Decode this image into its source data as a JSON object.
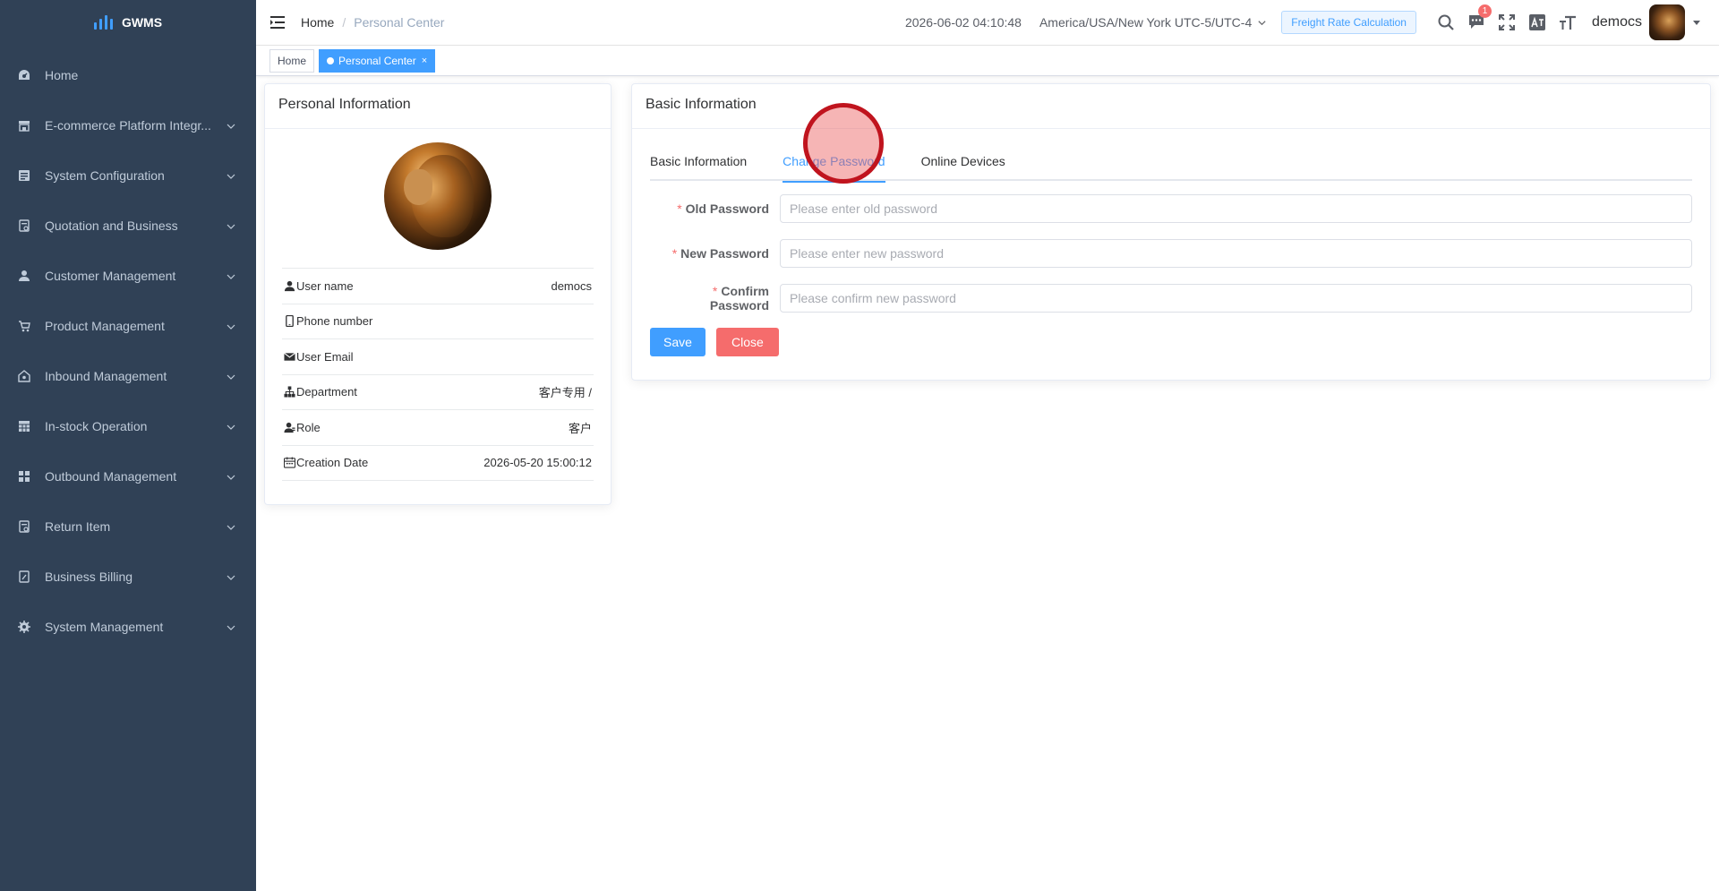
{
  "app": {
    "name": "GWMS"
  },
  "sidebar": {
    "items": [
      {
        "label": "Home",
        "icon": "dashboard-icon",
        "expandable": false
      },
      {
        "label": "E-commerce Platform Integr...",
        "icon": "store-icon",
        "expandable": true
      },
      {
        "label": "System Configuration",
        "icon": "config-icon",
        "expandable": true
      },
      {
        "label": "Quotation and Business",
        "icon": "quotation-icon",
        "expandable": true
      },
      {
        "label": "Customer Management",
        "icon": "user-icon",
        "expandable": true
      },
      {
        "label": "Product Management",
        "icon": "cart-icon",
        "expandable": true
      },
      {
        "label": "Inbound Management",
        "icon": "warehouse-icon",
        "expandable": true
      },
      {
        "label": "In-stock Operation",
        "icon": "table-icon",
        "expandable": true
      },
      {
        "label": "Outbound Management",
        "icon": "grid-icon",
        "expandable": true
      },
      {
        "label": "Return Item",
        "icon": "return-icon",
        "expandable": true
      },
      {
        "label": "Business Billing",
        "icon": "billing-icon",
        "expandable": true
      },
      {
        "label": "System Management",
        "icon": "gear-icon",
        "expandable": true
      }
    ]
  },
  "navbar": {
    "breadcrumb": {
      "home": "Home",
      "separator": "/",
      "current": "Personal Center"
    },
    "datetime": "2026-06-02 04:10:48",
    "timezone": "America/USA/New York UTC-5/UTC-4",
    "freight_button": "Freight Rate Calculation",
    "message_badge": "1",
    "username": "democs"
  },
  "tags": {
    "home": "Home",
    "active": "Personal Center",
    "close_glyph": "×"
  },
  "personal_info": {
    "title": "Personal Information",
    "rows": [
      {
        "label": "User name",
        "value": "democs"
      },
      {
        "label": "Phone number",
        "value": ""
      },
      {
        "label": "User Email",
        "value": ""
      },
      {
        "label": "Department",
        "value": "客户专用 /"
      },
      {
        "label": "Role",
        "value": "客户"
      },
      {
        "label": "Creation Date",
        "value": "2026-05-20 15:00:12"
      }
    ]
  },
  "basic_info": {
    "title": "Basic Information",
    "tabs": [
      {
        "label": "Basic Information",
        "active": false
      },
      {
        "label": "Change Password",
        "active": true
      },
      {
        "label": "Online Devices",
        "active": false
      }
    ],
    "form": {
      "required_mark": "*",
      "old_password": {
        "label": "Old Password",
        "placeholder": "Please enter old password",
        "value": ""
      },
      "new_password": {
        "label": "New Password",
        "placeholder": "Please enter new password",
        "value": ""
      },
      "confirm_password": {
        "label": "Confirm Password",
        "placeholder": "Please confirm new password",
        "value": ""
      }
    },
    "buttons": {
      "save": "Save",
      "close": "Close"
    }
  },
  "colors": {
    "sidebar_bg": "#304156",
    "sidebar_text": "#bfcbd9",
    "primary": "#409eff",
    "danger": "#f56c6c"
  }
}
